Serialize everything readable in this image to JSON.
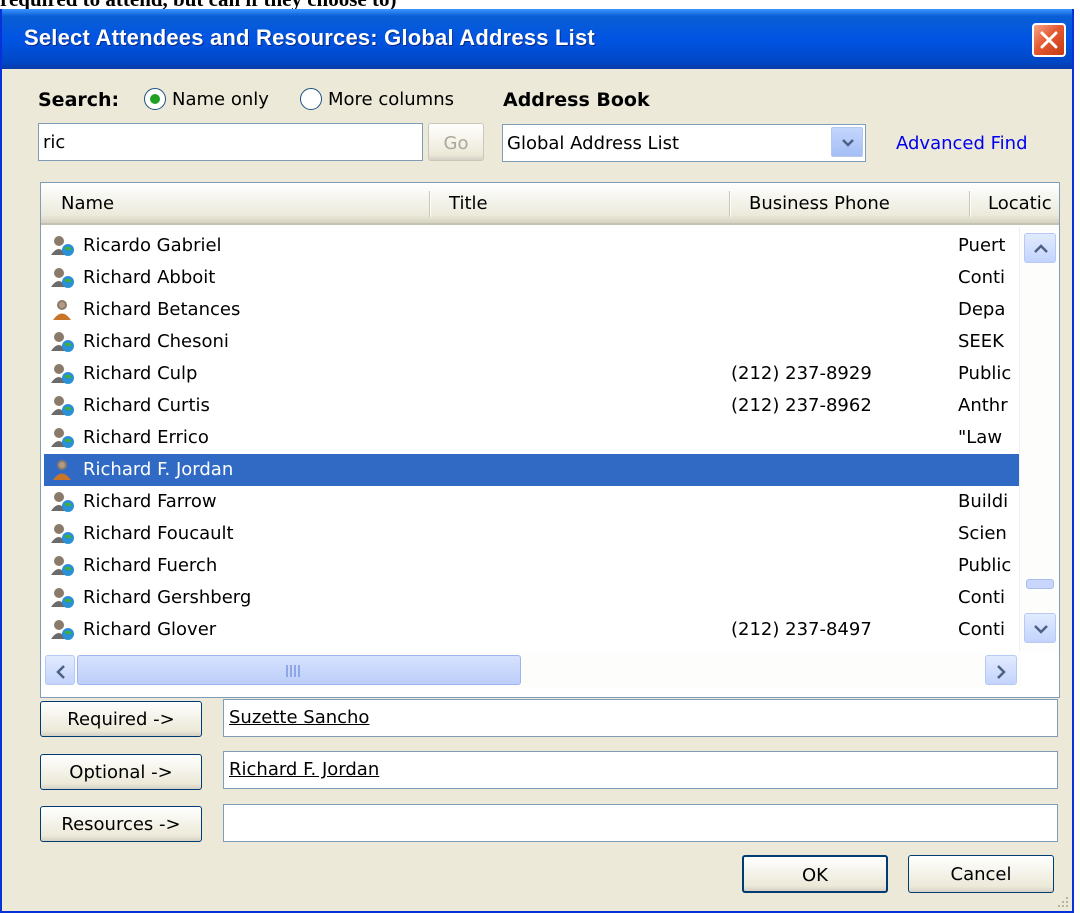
{
  "page_top_text": "required to attend, but can if they choose to)",
  "dialog": {
    "title": "Select Attendees and Resources: Global Address List",
    "search_label": "Search:",
    "radio_name_only": "Name only",
    "radio_more_columns": "More columns",
    "address_book_label": "Address Book",
    "search_value": "ric",
    "go_label": "Go",
    "address_book_value": "Global Address List",
    "advanced_find": "Advanced Find"
  },
  "columns": {
    "name": "Name",
    "title": "Title",
    "phone": "Business Phone",
    "location": "Locatic"
  },
  "rows": [
    {
      "name": "Ricardo Gabriel",
      "phone": "",
      "location": "Puert",
      "icon": "contact-icon"
    },
    {
      "name": "Richard Abboit",
      "phone": "",
      "location": "Conti",
      "icon": "contact-icon"
    },
    {
      "name": "Richard Betances",
      "phone": "",
      "location": "Depa",
      "icon": "user-icon"
    },
    {
      "name": "Richard Chesoni",
      "phone": "",
      "location": "SEEK",
      "icon": "contact-icon"
    },
    {
      "name": "Richard Culp",
      "phone": "(212) 237-8929",
      "location": "Public",
      "icon": "contact-icon"
    },
    {
      "name": "Richard Curtis",
      "phone": "(212) 237-8962",
      "location": "Anthr",
      "icon": "contact-icon"
    },
    {
      "name": "Richard Errico",
      "phone": "",
      "location": "\"Law",
      "icon": "contact-icon"
    },
    {
      "name": "Richard F. Jordan",
      "phone": "",
      "location": "",
      "icon": "user-icon",
      "selected": true
    },
    {
      "name": "Richard Farrow",
      "phone": "",
      "location": "Buildi",
      "icon": "contact-icon"
    },
    {
      "name": "Richard Foucault",
      "phone": "",
      "location": "Scien",
      "icon": "contact-icon"
    },
    {
      "name": "Richard Fuerch",
      "phone": "",
      "location": "Public",
      "icon": "contact-icon"
    },
    {
      "name": "Richard Gershberg",
      "phone": "",
      "location": "Conti",
      "icon": "contact-icon"
    },
    {
      "name": "Richard Glover",
      "phone": "(212) 237-8497",
      "location": "Conti",
      "icon": "contact-icon"
    }
  ],
  "attendees": {
    "required_label": "Required ->",
    "required_value": "Suzette Sancho",
    "optional_label": "Optional ->",
    "optional_value": "Richard F. Jordan",
    "resources_label": "Resources ->",
    "resources_value": ""
  },
  "buttons": {
    "ok": "OK",
    "cancel": "Cancel"
  },
  "colors": {
    "titlebar": "#0054e3",
    "selection": "#316ac5",
    "dialog_bg": "#ece9d8"
  }
}
